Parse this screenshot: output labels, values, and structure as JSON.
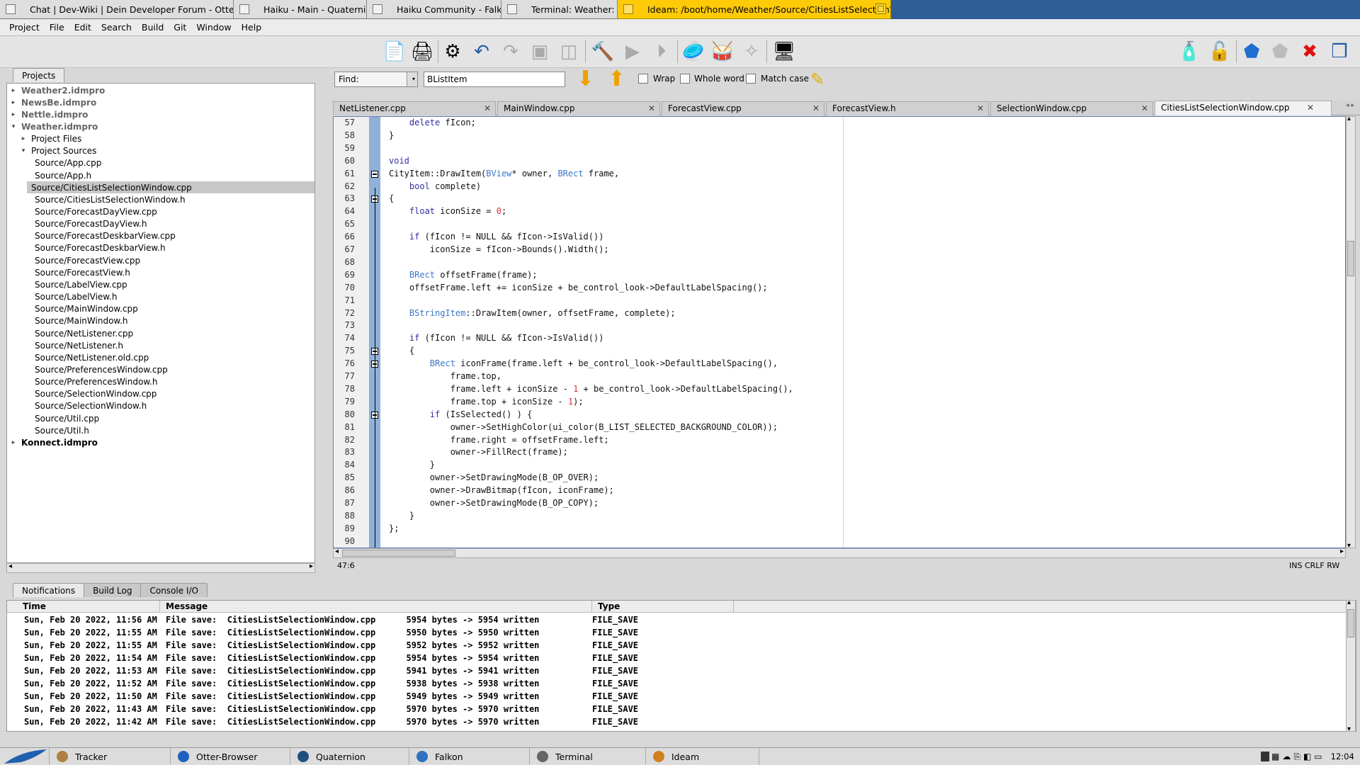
{
  "window_tabs": [
    {
      "label": "Chat | Dev-Wiki | Dein Developer Forum - Otter Browser",
      "active": false
    },
    {
      "label": "Haiku - Main - Quaternion",
      "active": false
    },
    {
      "label": "Haiku Community - Falkon",
      "active": false
    },
    {
      "label": "Terminal: Weather: --",
      "active": false
    },
    {
      "label": "Ideam: /boot/home/Weather/Source/CitiesListSelectionWindow.cpp",
      "active": true
    }
  ],
  "menu": [
    "Project",
    "File",
    "Edit",
    "Search",
    "Build",
    "Git",
    "Window",
    "Help"
  ],
  "toolbar_icons": [
    "folder-open-icon",
    "project-open-icon",
    "settings-icon",
    "undo-icon",
    "redo-icon",
    "save-icon",
    "save-all-icon",
    "build-icon",
    "run-icon",
    "debug-icon",
    "find-icon",
    "replace-icon",
    "find-files-icon",
    "console-icon",
    "clean-icon",
    "lock-icon",
    "back-icon",
    "forward-icon",
    "close-file-icon",
    "show-panels-icon"
  ],
  "projects_tab": "Projects",
  "tree": [
    {
      "label": "Weather2.idmpro",
      "type": "project",
      "indent": 0,
      "arrow": "▸"
    },
    {
      "label": "NewsBe.idmpro",
      "type": "project",
      "indent": 0,
      "arrow": "▸"
    },
    {
      "label": "Nettle.idmpro",
      "type": "project",
      "indent": 0,
      "arrow": "▸"
    },
    {
      "label": "Weather.idmpro",
      "type": "project",
      "indent": 0,
      "arrow": "▾"
    },
    {
      "label": "Project Files",
      "type": "folder",
      "indent": 1,
      "arrow": "▸"
    },
    {
      "label": "Project Sources",
      "type": "folder",
      "indent": 1,
      "arrow": "▾"
    },
    {
      "label": "Source/App.cpp",
      "type": "file",
      "indent": 2
    },
    {
      "label": "Source/App.h",
      "type": "file",
      "indent": 2
    },
    {
      "label": "Source/CitiesListSelectionWindow.cpp",
      "type": "file",
      "indent": 2,
      "selected": true
    },
    {
      "label": "Source/CitiesListSelectionWindow.h",
      "type": "file",
      "indent": 2
    },
    {
      "label": "Source/ForecastDayView.cpp",
      "type": "file",
      "indent": 2
    },
    {
      "label": "Source/ForecastDayView.h",
      "type": "file",
      "indent": 2
    },
    {
      "label": "Source/ForecastDeskbarView.cpp",
      "type": "file",
      "indent": 2
    },
    {
      "label": "Source/ForecastDeskbarView.h",
      "type": "file",
      "indent": 2
    },
    {
      "label": "Source/ForecastView.cpp",
      "type": "file",
      "indent": 2
    },
    {
      "label": "Source/ForecastView.h",
      "type": "file",
      "indent": 2
    },
    {
      "label": "Source/LabelView.cpp",
      "type": "file",
      "indent": 2
    },
    {
      "label": "Source/LabelView.h",
      "type": "file",
      "indent": 2
    },
    {
      "label": "Source/MainWindow.cpp",
      "type": "file",
      "indent": 2
    },
    {
      "label": "Source/MainWindow.h",
      "type": "file",
      "indent": 2
    },
    {
      "label": "Source/NetListener.cpp",
      "type": "file",
      "indent": 2
    },
    {
      "label": "Source/NetListener.h",
      "type": "file",
      "indent": 2
    },
    {
      "label": "Source/NetListener.old.cpp",
      "type": "file",
      "indent": 2
    },
    {
      "label": "Source/PreferencesWindow.cpp",
      "type": "file",
      "indent": 2
    },
    {
      "label": "Source/PreferencesWindow.h",
      "type": "file",
      "indent": 2
    },
    {
      "label": "Source/SelectionWindow.cpp",
      "type": "file",
      "indent": 2
    },
    {
      "label": "Source/SelectionWindow.h",
      "type": "file",
      "indent": 2
    },
    {
      "label": "Source/Util.cpp",
      "type": "file",
      "indent": 2
    },
    {
      "label": "Source/Util.h",
      "type": "file",
      "indent": 2
    },
    {
      "label": "Konnect.idmpro",
      "type": "project-dark",
      "indent": 0,
      "arrow": "▸"
    }
  ],
  "find": {
    "combo": "Find:",
    "value": "BListItem",
    "wrap": "Wrap",
    "whole_word": "Whole word",
    "match_case": "Match case"
  },
  "editor_tabs": [
    {
      "label": "NetListener.cpp",
      "active": false
    },
    {
      "label": "MainWindow.cpp",
      "active": false
    },
    {
      "label": "ForecastView.cpp",
      "active": false
    },
    {
      "label": "ForecastView.h",
      "active": false
    },
    {
      "label": "SelectionWindow.cpp",
      "active": false
    },
    {
      "label": "CitiesListSelectionWindow.cpp",
      "active": true
    }
  ],
  "code_lines": [
    {
      "n": "57",
      "t": "\tdelete fIcon;"
    },
    {
      "n": "58",
      "t": "}"
    },
    {
      "n": "59",
      "t": ""
    },
    {
      "n": "60",
      "t": "void"
    },
    {
      "n": "61",
      "t": "CityItem::DrawItem(BView* owner, BRect frame,"
    },
    {
      "n": "62",
      "t": "\tbool complete)"
    },
    {
      "n": "63",
      "t": "{"
    },
    {
      "n": "64",
      "t": "\tfloat iconSize = 0;"
    },
    {
      "n": "65",
      "t": ""
    },
    {
      "n": "66",
      "t": "\tif (fIcon != NULL && fIcon->IsValid())"
    },
    {
      "n": "67",
      "t": "\t\ticonSize = fIcon->Bounds().Width();"
    },
    {
      "n": "68",
      "t": ""
    },
    {
      "n": "69",
      "t": "\tBRect offsetFrame(frame);"
    },
    {
      "n": "70",
      "t": "\toffsetFrame.left += iconSize + be_control_look->DefaultLabelSpacing();"
    },
    {
      "n": "71",
      "t": ""
    },
    {
      "n": "72",
      "t": "\tBStringItem::DrawItem(owner, offsetFrame, complete);"
    },
    {
      "n": "73",
      "t": ""
    },
    {
      "n": "74",
      "t": "\tif (fIcon != NULL && fIcon->IsValid())"
    },
    {
      "n": "75",
      "t": "\t{"
    },
    {
      "n": "76",
      "t": "\t\tBRect iconFrame(frame.left + be_control_look->DefaultLabelSpacing(),"
    },
    {
      "n": "77",
      "t": "\t\t\tframe.top,"
    },
    {
      "n": "78",
      "t": "\t\t\tframe.left + iconSize - 1 + be_control_look->DefaultLabelSpacing(),"
    },
    {
      "n": "79",
      "t": "\t\t\tframe.top + iconSize - 1);"
    },
    {
      "n": "80",
      "t": "\t\tif (IsSelected() ) {"
    },
    {
      "n": "81",
      "t": "\t\t\towner->SetHighColor(ui_color(B_LIST_SELECTED_BACKGROUND_COLOR));"
    },
    {
      "n": "82",
      "t": "\t\t\tframe.right = offsetFrame.left;"
    },
    {
      "n": "83",
      "t": "\t\t\towner->FillRect(frame);"
    },
    {
      "n": "84",
      "t": "\t\t}"
    },
    {
      "n": "85",
      "t": "\t\towner->SetDrawingMode(B_OP_OVER);"
    },
    {
      "n": "86",
      "t": "\t\towner->DrawBitmap(fIcon, iconFrame);"
    },
    {
      "n": "87",
      "t": "\t\towner->SetDrawingMode(B_OP_COPY);"
    },
    {
      "n": "88",
      "t": "\t}"
    },
    {
      "n": "89",
      "t": "};"
    },
    {
      "n": "90",
      "t": ""
    }
  ],
  "status": {
    "position": "47:6",
    "mode": "INS CRLF RW"
  },
  "bottom_tabs": [
    "Notifications",
    "Build Log",
    "Console I/O"
  ],
  "notif_headers": [
    "Time",
    "Message",
    "Type"
  ],
  "notifications": [
    {
      "time": "Sun, Feb 20 2022, 11:56 AM",
      "msg": "File save:  CitiesListSelectionWindow.cpp      5954 bytes -> 5954 written",
      "type": "FILE_SAVE"
    },
    {
      "time": "Sun, Feb 20 2022, 11:55 AM",
      "msg": "File save:  CitiesListSelectionWindow.cpp      5950 bytes -> 5950 written",
      "type": "FILE_SAVE"
    },
    {
      "time": "Sun, Feb 20 2022, 11:55 AM",
      "msg": "File save:  CitiesListSelectionWindow.cpp      5952 bytes -> 5952 written",
      "type": "FILE_SAVE"
    },
    {
      "time": "Sun, Feb 20 2022, 11:54 AM",
      "msg": "File save:  CitiesListSelectionWindow.cpp      5954 bytes -> 5954 written",
      "type": "FILE_SAVE"
    },
    {
      "time": "Sun, Feb 20 2022, 11:53 AM",
      "msg": "File save:  CitiesListSelectionWindow.cpp      5941 bytes -> 5941 written",
      "type": "FILE_SAVE"
    },
    {
      "time": "Sun, Feb 20 2022, 11:52 AM",
      "msg": "File save:  CitiesListSelectionWindow.cpp      5938 bytes -> 5938 written",
      "type": "FILE_SAVE"
    },
    {
      "time": "Sun, Feb 20 2022, 11:50 AM",
      "msg": "File save:  CitiesListSelectionWindow.cpp      5949 bytes -> 5949 written",
      "type": "FILE_SAVE"
    },
    {
      "time": "Sun, Feb 20 2022, 11:43 AM",
      "msg": "File save:  CitiesListSelectionWindow.cpp      5970 bytes -> 5970 written",
      "type": "FILE_SAVE"
    },
    {
      "time": "Sun, Feb 20 2022, 11:42 AM",
      "msg": "File save:  CitiesListSelectionWindow.cpp      5970 bytes -> 5970 written",
      "type": "FILE_SAVE"
    }
  ],
  "deskbar": [
    {
      "label": "Tracker",
      "icon": "tracker-icon"
    },
    {
      "label": "Otter-Browser",
      "icon": "otter-browser-icon"
    },
    {
      "label": "Quaternion",
      "icon": "quaternion-icon"
    },
    {
      "label": "Falkon",
      "icon": "falkon-icon"
    },
    {
      "label": "Terminal",
      "icon": "terminal-icon"
    },
    {
      "label": "Ideam",
      "icon": "ideam-icon"
    }
  ],
  "clock": "12:04",
  "colors": {
    "accent": "#ffcb08",
    "title_bg": "#2e5e96",
    "change_bar": "#8fb0d8",
    "keyword": "#3030a0",
    "type": "#3c78c8",
    "number": "#e03030"
  }
}
